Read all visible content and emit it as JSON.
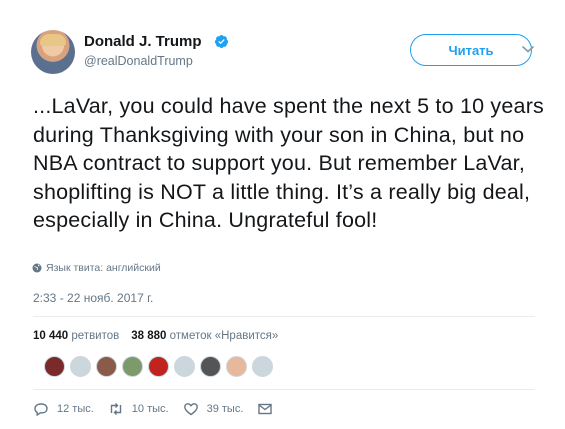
{
  "tweet": {
    "display_name": "Donald J. Trump",
    "handle": "@realDonaldTrump",
    "follow_label": "Читать",
    "text": "...LaVar, you could have spent the next 5 to 10 years during Thanksgiving with your son in China, but no NBA contract to support you. But remember LaVar, shoplifting is NOT a little thing. It’s a really big deal, especially in China. Ungrateful fool!",
    "language_label": "Язык твита: английский",
    "timestamp": "2:33 - 22 нояб. 2017 г."
  },
  "stats": {
    "retweets_count": "10 440",
    "retweets_label": "ретвитов",
    "likes_count": "38 880",
    "likes_label": "отметок «Нравится»"
  },
  "liker_avatars": [
    {
      "color": "#7a2a2a"
    },
    {
      "color": "#ccd6dd"
    },
    {
      "color": "#8a5a4a"
    },
    {
      "color": "#7d9a6a"
    },
    {
      "color": "#c0241e"
    },
    {
      "color": "#ccd6dd"
    },
    {
      "color": "#555555"
    },
    {
      "color": "#e8b89a"
    },
    {
      "color": "#ccd6dd"
    }
  ],
  "actions": {
    "replies": "12 тыс.",
    "retweets": "10 тыс.",
    "likes": "39 тыс."
  },
  "colors": {
    "accent": "#1da1f2",
    "text": "#14171a",
    "muted": "#657786"
  }
}
